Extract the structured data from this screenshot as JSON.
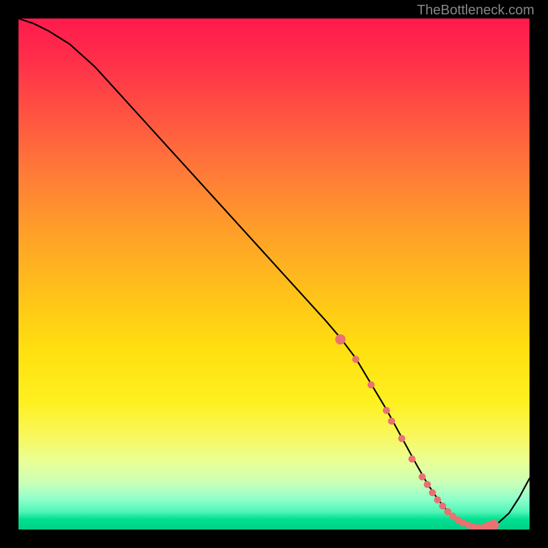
{
  "watermark": "TheBottleneck.com",
  "chart_data": {
    "type": "line",
    "title": "",
    "xlabel": "",
    "ylabel": "",
    "xlim": [
      0,
      100
    ],
    "ylim": [
      0,
      100
    ],
    "series": [
      {
        "name": "bottleneck-curve",
        "x": [
          0,
          3,
          6,
          10,
          15,
          20,
          25,
          30,
          35,
          40,
          45,
          50,
          55,
          60,
          63,
          66,
          69,
          72,
          75,
          78,
          80,
          82,
          84,
          86,
          88,
          90,
          92,
          94,
          96,
          98,
          100
        ],
        "values": [
          100,
          99,
          97.5,
          95,
          90.5,
          85,
          79.5,
          74,
          68.5,
          63,
          57.5,
          52,
          46.5,
          41,
          37.5,
          33.5,
          28.5,
          23.5,
          18,
          12.5,
          9,
          6,
          3.5,
          1.8,
          0.8,
          0.4,
          0.6,
          1.4,
          3.2,
          6.3,
          10
        ]
      }
    ],
    "markers": {
      "name": "highlight-dots",
      "x": [
        63,
        66,
        69,
        72,
        73,
        75,
        77,
        79,
        80,
        81,
        82,
        83,
        84,
        85,
        86,
        87,
        88,
        89,
        90,
        91,
        92,
        93
      ],
      "values": [
        37.2,
        33.3,
        28.3,
        23.3,
        21.2,
        17.8,
        13.8,
        10.3,
        8.8,
        7.2,
        5.8,
        4.6,
        3.5,
        2.6,
        1.85,
        1.3,
        0.85,
        0.55,
        0.4,
        0.4,
        0.6,
        0.9
      ]
    },
    "gradient_stops": [
      {
        "pos": 0,
        "color": "#ff1a4d"
      },
      {
        "pos": 0.08,
        "color": "#ff2e4a"
      },
      {
        "pos": 0.18,
        "color": "#ff5042"
      },
      {
        "pos": 0.3,
        "color": "#ff7a38"
      },
      {
        "pos": 0.42,
        "color": "#ffa028"
      },
      {
        "pos": 0.55,
        "color": "#ffc518"
      },
      {
        "pos": 0.65,
        "color": "#ffe010"
      },
      {
        "pos": 0.75,
        "color": "#fff020"
      },
      {
        "pos": 0.82,
        "color": "#f8f860"
      },
      {
        "pos": 0.87,
        "color": "#e8ff99"
      },
      {
        "pos": 0.91,
        "color": "#c8ffb8"
      },
      {
        "pos": 0.94,
        "color": "#90ffcc"
      },
      {
        "pos": 0.965,
        "color": "#50f5b8"
      },
      {
        "pos": 0.98,
        "color": "#00e090"
      },
      {
        "pos": 1.0,
        "color": "#00d088"
      }
    ],
    "marker_color": "#e97171",
    "big_marker_indices": [
      0,
      20,
      21
    ]
  }
}
